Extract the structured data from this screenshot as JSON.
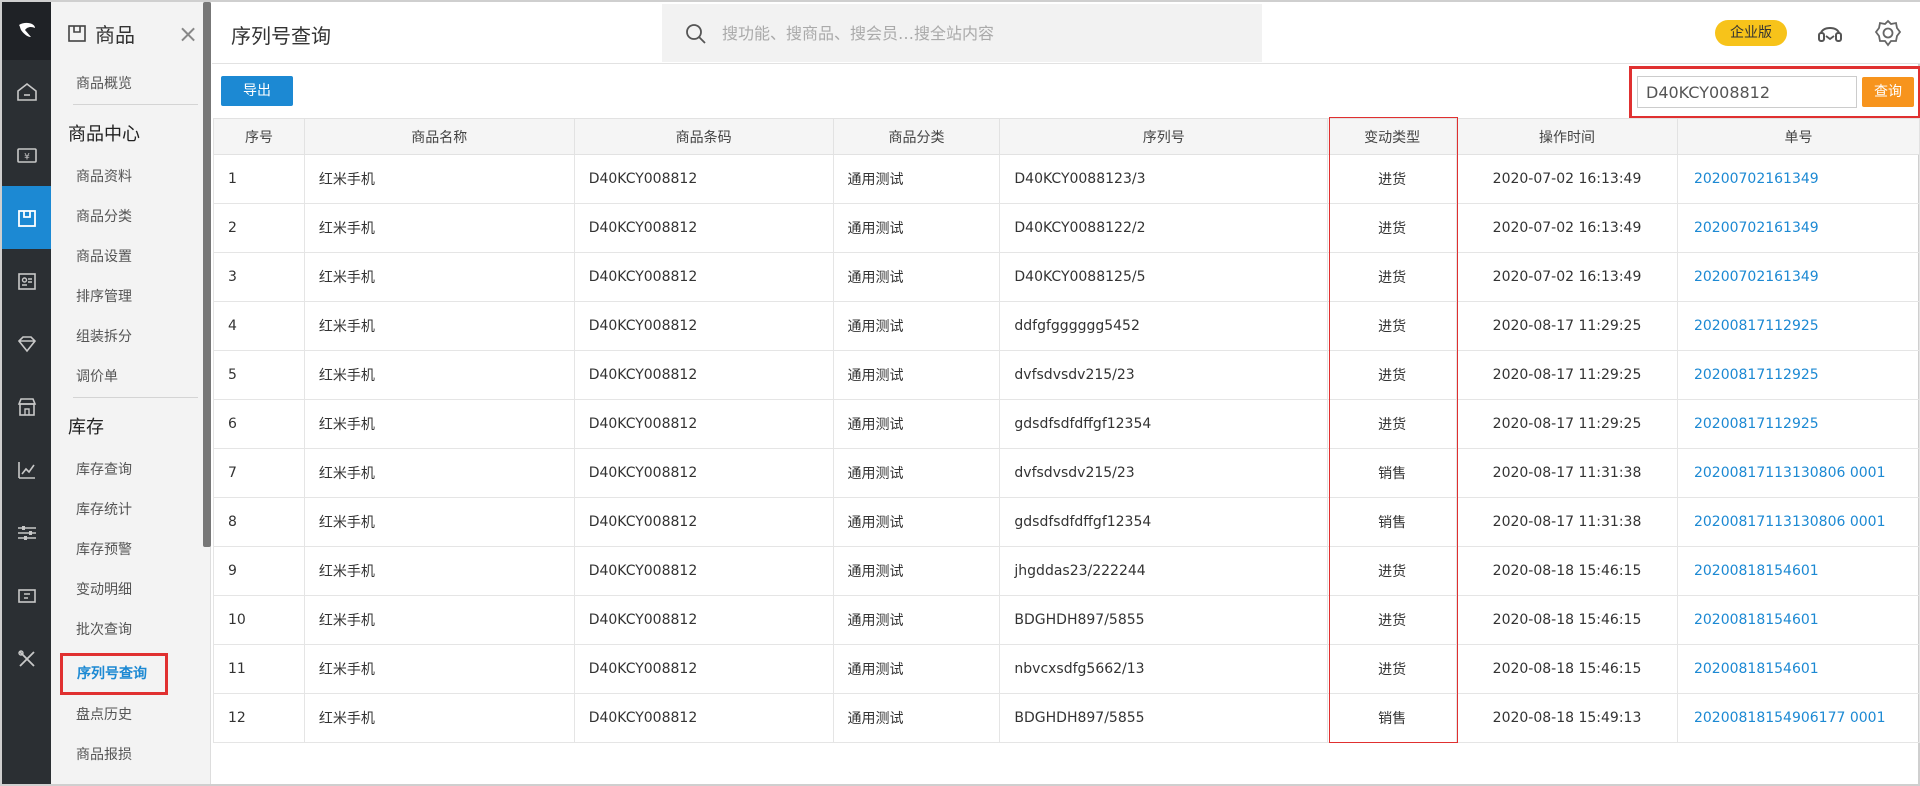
{
  "header": {
    "page_title": "序列号查询",
    "search_placeholder": "搜功能、搜商品、搜会员…搜全站内容",
    "edition_badge": "企业版"
  },
  "rail": {
    "items": [
      "home-icon",
      "cash-icon",
      "goods-icon",
      "member-card-icon",
      "diamond-icon",
      "shop-icon",
      "chart-icon",
      "settings-sliders-icon",
      "ticket-icon",
      "tools-icon"
    ],
    "active_index": 2
  },
  "submenu": {
    "title": "商品",
    "close": "×",
    "items_top": [
      {
        "label": "商品概览"
      }
    ],
    "group1": {
      "title": "商品中心",
      "items": [
        {
          "label": "商品资料"
        },
        {
          "label": "商品分类"
        },
        {
          "label": "商品设置"
        },
        {
          "label": "排序管理"
        },
        {
          "label": "组装拆分"
        },
        {
          "label": "调价单"
        }
      ]
    },
    "group2": {
      "title": "库存",
      "items": [
        {
          "label": "库存查询"
        },
        {
          "label": "库存统计"
        },
        {
          "label": "库存预警"
        },
        {
          "label": "变动明细"
        },
        {
          "label": "批次查询"
        },
        {
          "label": "序列号查询"
        },
        {
          "label": "盘点历史"
        },
        {
          "label": "商品报损"
        }
      ]
    }
  },
  "toolbar": {
    "export_label": "导出",
    "query_value": "D40KCY008812",
    "query_label": "查询"
  },
  "table": {
    "columns": [
      "序号",
      "商品名称",
      "商品条码",
      "商品分类",
      "序列号",
      "变动类型",
      "操作时间",
      "单号"
    ],
    "rows": [
      [
        "1",
        "红米手机",
        "D40KCY008812",
        "通用测试",
        "D40KCY0088123/3",
        "进货",
        "2020-07-02 16:13:49",
        "20200702161349"
      ],
      [
        "2",
        "红米手机",
        "D40KCY008812",
        "通用测试",
        "D40KCY0088122/2",
        "进货",
        "2020-07-02 16:13:49",
        "20200702161349"
      ],
      [
        "3",
        "红米手机",
        "D40KCY008812",
        "通用测试",
        "D40KCY0088125/5",
        "进货",
        "2020-07-02 16:13:49",
        "20200702161349"
      ],
      [
        "4",
        "红米手机",
        "D40KCY008812",
        "通用测试",
        "ddfgfgggggg5452",
        "进货",
        "2020-08-17 11:29:25",
        "20200817112925"
      ],
      [
        "5",
        "红米手机",
        "D40KCY008812",
        "通用测试",
        "dvfsdvsdv215/23",
        "进货",
        "2020-08-17 11:29:25",
        "20200817112925"
      ],
      [
        "6",
        "红米手机",
        "D40KCY008812",
        "通用测试",
        "gdsdfsdfdffgf12354",
        "进货",
        "2020-08-17 11:29:25",
        "20200817112925"
      ],
      [
        "7",
        "红米手机",
        "D40KCY008812",
        "通用测试",
        "dvfsdvsdv215/23",
        "销售",
        "2020-08-17 11:31:38",
        "20200817113130806 0001"
      ],
      [
        "8",
        "红米手机",
        "D40KCY008812",
        "通用测试",
        "gdsdfsdfdffgf12354",
        "销售",
        "2020-08-17 11:31:38",
        "20200817113130806 0001"
      ],
      [
        "9",
        "红米手机",
        "D40KCY008812",
        "通用测试",
        "jhgddas23/222244",
        "进货",
        "2020-08-18 15:46:15",
        "20200818154601"
      ],
      [
        "10",
        "红米手机",
        "D40KCY008812",
        "通用测试",
        "BDGHDH897/5855",
        "进货",
        "2020-08-18 15:46:15",
        "20200818154601"
      ],
      [
        "11",
        "红米手机",
        "D40KCY008812",
        "通用测试",
        "nbvcxsdfg5662/13",
        "进货",
        "2020-08-18 15:46:15",
        "20200818154601"
      ],
      [
        "12",
        "红米手机",
        "D40KCY008812",
        "通用测试",
        "BDGHDH897/5855",
        "销售",
        "2020-08-18 15:49:13",
        "20200818154906177 0001"
      ]
    ]
  },
  "colors": {
    "accent": "#1c89d3",
    "rail_bg": "#2b2f33",
    "highlight": "#e03030",
    "query_button": "#f7941d",
    "badge": "#f7c31a"
  }
}
